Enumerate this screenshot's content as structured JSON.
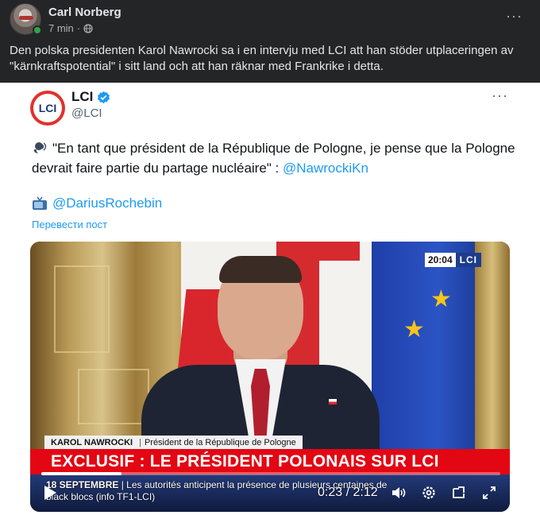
{
  "post": {
    "author": "Carl Norberg",
    "time": "7 min",
    "separator": "·",
    "more": "···",
    "text": "Den polska presidenten Karol Nawrocki sa i en intervju med LCI att han stöder utplaceringen av \"kärnkraftspotential\" i sitt land och att han räknar med Frankrike i detta."
  },
  "tweet": {
    "logo_text": "LCI",
    "name": "LCI",
    "handle": "@LCI",
    "more": "···",
    "quote": "\"En tant que président de la République de Pologne, je pense que la Pologne devrait faire partie du partage nucléaire\" : ",
    "quote_mention": "@NawrockiKn",
    "credit_mention": "@DariusRochebin",
    "translate": "Перевести пост"
  },
  "video": {
    "clock": "20:04",
    "channel": "LCI",
    "lower_name": "KAROL NAWROCKI",
    "lower_sep": "|",
    "lower_title": "Président de la République de Pologne",
    "headline": "EXCLUSIF : LE PRÉSIDENT POLONAIS SUR LCI",
    "ticker_date": "18 SEPTEMBRE",
    "ticker_text": " | Les autorités anticipent la présence de plusieurs centaines de black blocs (info TF1-LCI)",
    "time_readout": "0:23 / 2:12",
    "progress_fraction": 0.174
  },
  "colors": {
    "link": "#1d9bf0",
    "lci_red": "#e30613",
    "online": "#31a24c"
  },
  "icons": [
    "globe-icon",
    "verified-icon",
    "speech-bubble-icon",
    "tv-icon",
    "play-icon",
    "volume-icon",
    "settings-icon",
    "pip-icon",
    "fullscreen-icon"
  ]
}
